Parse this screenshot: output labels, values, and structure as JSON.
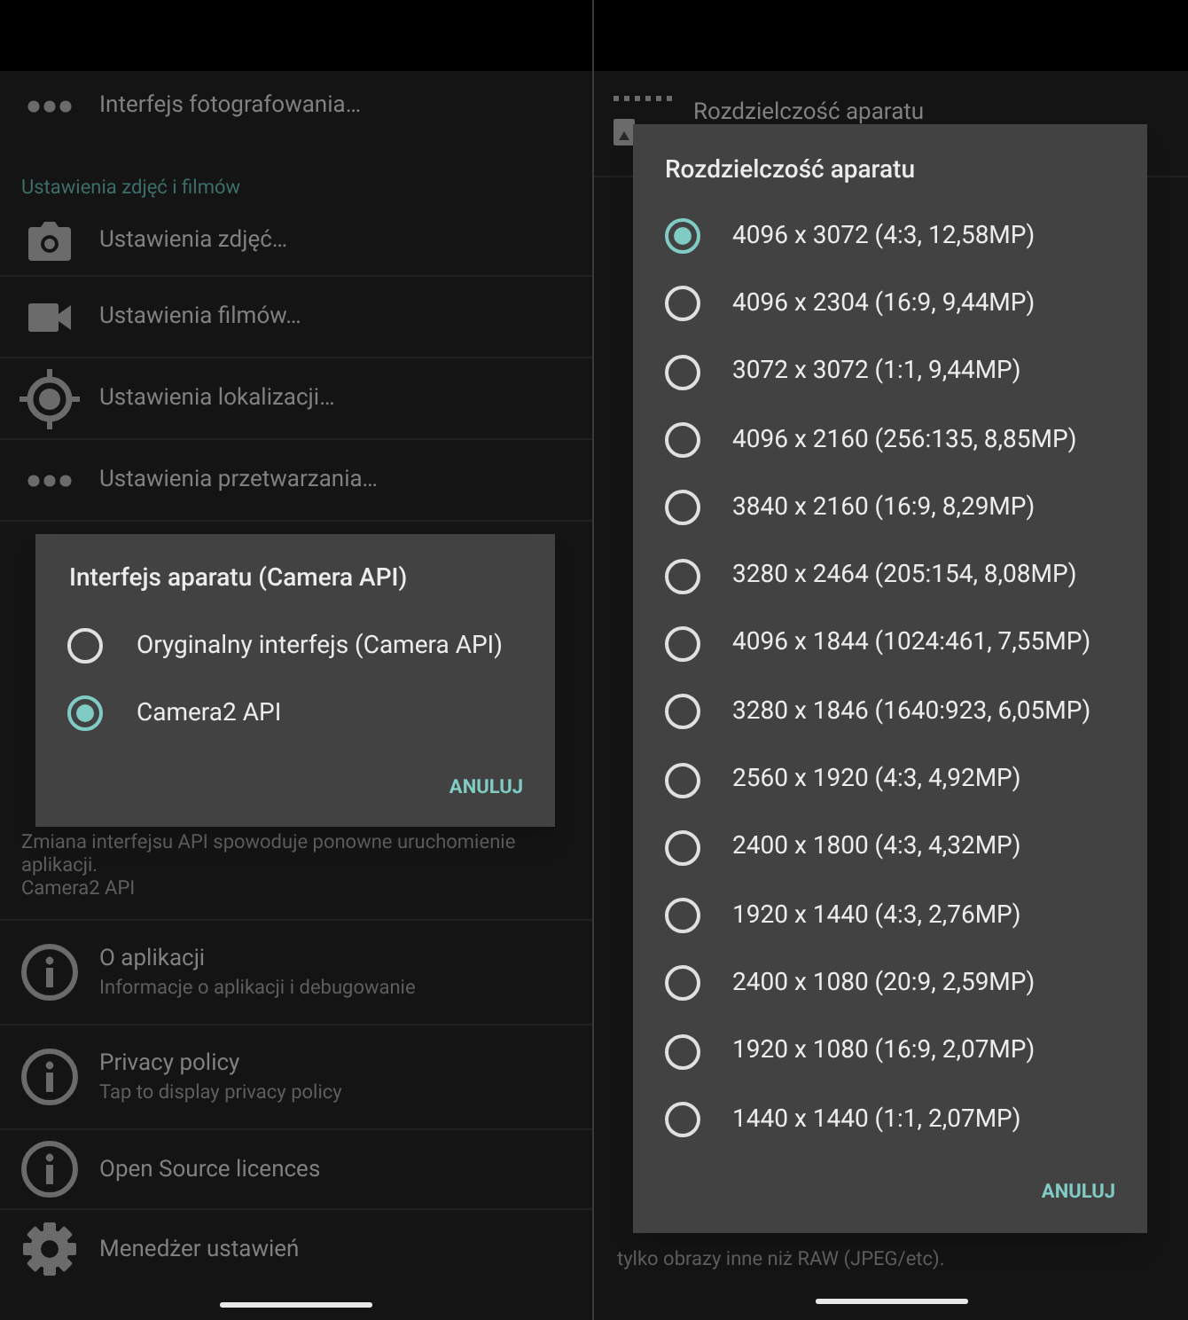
{
  "left_screen": {
    "background_top": [
      {
        "kind": "row",
        "title": "Interfejs fotografowania…"
      },
      {
        "kind": "header",
        "title": "Ustawienia zdjęć i filmów"
      },
      {
        "kind": "row",
        "title": "Ustawienia zdjęć…"
      },
      {
        "kind": "row",
        "title": "Ustawienia filmów…"
      },
      {
        "kind": "row",
        "title": "Ustawienia lokalizacji…"
      },
      {
        "kind": "row",
        "title": "Ustawienia przetwarzania…"
      }
    ],
    "note": [
      "Zmiana interfejsu API spowoduje ponowne uruchomienie aplikacji.",
      "Camera2 API"
    ],
    "background_bottom": [
      {
        "title": "O aplikacji",
        "subtitle": "Informacje o aplikacji i debugowanie"
      },
      {
        "title": "Privacy policy",
        "subtitle": "Tap to display privacy policy"
      },
      {
        "title": "Open Source licences"
      },
      {
        "title": "Menedżer ustawień"
      }
    ],
    "dialog": {
      "title": "Interfejs aparatu (Camera API)",
      "options": [
        {
          "label": "Oryginalny interfejs (Camera API)",
          "selected": false
        },
        {
          "label": "Camera2 API",
          "selected": true
        }
      ],
      "button": "ANULUJ"
    }
  },
  "right_screen": {
    "header": "Rozdzielczość aparatu",
    "footer_text": "tylko obrazy inne niż RAW (JPEG/etc).",
    "dialog": {
      "title": "Rozdzielczość aparatu",
      "options": [
        {
          "label": "4096 x 3072 (4:3, 12,58MP)",
          "selected": true
        },
        {
          "label": "4096 x 2304 (16:9, 9,44MP)",
          "selected": false
        },
        {
          "label": "3072 x 3072 (1:1, 9,44MP)",
          "selected": false
        },
        {
          "label": "4096 x 2160 (256:135, 8,85MP)",
          "selected": false
        },
        {
          "label": "3840 x 2160 (16:9, 8,29MP)",
          "selected": false
        },
        {
          "label": "3280 x 2464 (205:154, 8,08MP)",
          "selected": false
        },
        {
          "label": "4096 x 1844 (1024:461, 7,55MP)",
          "selected": false
        },
        {
          "label": "3280 x 1846 (1640:923, 6,05MP)",
          "selected": false
        },
        {
          "label": "2560 x 1920 (4:3, 4,92MP)",
          "selected": false
        },
        {
          "label": "2400 x 1800 (4:3, 4,32MP)",
          "selected": false
        },
        {
          "label": "1920 x 1440 (4:3, 2,76MP)",
          "selected": false
        },
        {
          "label": "2400 x 1080 (20:9, 2,59MP)",
          "selected": false
        },
        {
          "label": "1920 x 1080 (16:9, 2,07MP)",
          "selected": false
        },
        {
          "label": "1440 x 1440 (1:1, 2,07MP)",
          "selected": false
        }
      ],
      "button": "ANULUJ"
    }
  }
}
